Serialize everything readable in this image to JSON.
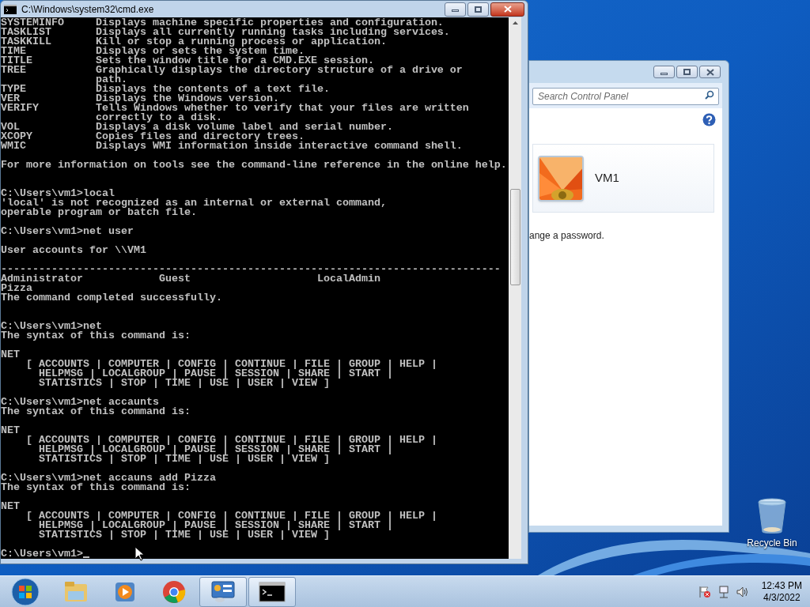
{
  "cmd_window": {
    "title": "C:\\Windows\\system32\\cmd.exe",
    "cursor": true,
    "console": [
      {
        "kind": "text",
        "text": "SYSTEMINFO     Displays machine specific properties and configuration."
      },
      {
        "kind": "text",
        "text": "TASKLIST       Displays all currently running tasks including services."
      },
      {
        "kind": "text",
        "text": "TASKKILL       Kill or stop a running process or application."
      },
      {
        "kind": "text",
        "text": "TIME           Displays or sets the system time."
      },
      {
        "kind": "text",
        "text": "TITLE          Sets the window title for a CMD.EXE session."
      },
      {
        "kind": "text",
        "text": "TREE           Graphically displays the directory structure of a drive or"
      },
      {
        "kind": "text",
        "text": "               path."
      },
      {
        "kind": "text",
        "text": "TYPE           Displays the contents of a text file."
      },
      {
        "kind": "text",
        "text": "VER            Displays the Windows version."
      },
      {
        "kind": "text",
        "text": "VERIFY         Tells Windows whether to verify that your files are written"
      },
      {
        "kind": "text",
        "text": "               correctly to a disk."
      },
      {
        "kind": "text",
        "text": "VOL            Displays a disk volume label and serial number."
      },
      {
        "kind": "text",
        "text": "XCOPY          Copies files and directory trees."
      },
      {
        "kind": "text",
        "text": "WMIC           Displays WMI information inside interactive command shell."
      },
      {
        "kind": "blank"
      },
      {
        "kind": "text",
        "text": "For more information on tools see the command-line reference in the online help."
      },
      {
        "kind": "blank"
      },
      {
        "kind": "blank"
      },
      {
        "kind": "text",
        "text": "C:\\Users\\vm1>local"
      },
      {
        "kind": "text",
        "text": "'local' is not recognized as an internal or external command,"
      },
      {
        "kind": "text",
        "text": "operable program or batch file."
      },
      {
        "kind": "blank"
      },
      {
        "kind": "text",
        "text": "C:\\Users\\vm1>net user"
      },
      {
        "kind": "blank"
      },
      {
        "kind": "text",
        "text": "User accounts for \\\\VM1"
      },
      {
        "kind": "blank"
      },
      {
        "kind": "text",
        "text": "-------------------------------------------------------------------------------"
      },
      {
        "kind": "text",
        "text": "Administrator            Guest                    LocalAdmin"
      },
      {
        "kind": "text",
        "text": "Pizza"
      },
      {
        "kind": "text",
        "text": "The command completed successfully."
      },
      {
        "kind": "blank"
      },
      {
        "kind": "blank"
      },
      {
        "kind": "text",
        "text": "C:\\Users\\vm1>net"
      },
      {
        "kind": "text",
        "text": "The syntax of this command is:"
      },
      {
        "kind": "blank"
      },
      {
        "kind": "text",
        "text": "NET"
      },
      {
        "kind": "text",
        "text": "    [ ACCOUNTS | COMPUTER | CONFIG | CONTINUE | FILE | GROUP | HELP |"
      },
      {
        "kind": "text",
        "text": "      HELPMSG | LOCALGROUP | PAUSE | SESSION | SHARE | START |"
      },
      {
        "kind": "text",
        "text": "      STATISTICS | STOP | TIME | USE | USER | VIEW ]"
      },
      {
        "kind": "blank"
      },
      {
        "kind": "text",
        "text": "C:\\Users\\vm1>net accaunts"
      },
      {
        "kind": "text",
        "text": "The syntax of this command is:"
      },
      {
        "kind": "blank"
      },
      {
        "kind": "text",
        "text": "NET"
      },
      {
        "kind": "text",
        "text": "    [ ACCOUNTS | COMPUTER | CONFIG | CONTINUE | FILE | GROUP | HELP |"
      },
      {
        "kind": "text",
        "text": "      HELPMSG | LOCALGROUP | PAUSE | SESSION | SHARE | START |"
      },
      {
        "kind": "text",
        "text": "      STATISTICS | STOP | TIME | USE | USER | VIEW ]"
      },
      {
        "kind": "blank"
      },
      {
        "kind": "text",
        "text": "C:\\Users\\vm1>net accauns add Pizza"
      },
      {
        "kind": "text",
        "text": "The syntax of this command is:"
      },
      {
        "kind": "blank"
      },
      {
        "kind": "text",
        "text": "NET"
      },
      {
        "kind": "text",
        "text": "    [ ACCOUNTS | COMPUTER | CONFIG | CONTINUE | FILE | GROUP | HELP |"
      },
      {
        "kind": "text",
        "text": "      HELPMSG | LOCALGROUP | PAUSE | SESSION | SHARE | START |"
      },
      {
        "kind": "text",
        "text": "      STATISTICS | STOP | TIME | USE | USER | VIEW ]"
      },
      {
        "kind": "blank"
      },
      {
        "kind": "text",
        "text": "C:\\Users\\vm1>"
      }
    ]
  },
  "control_panel": {
    "search": {
      "placeholder": "Search Control Panel"
    },
    "account": {
      "name": "VM1"
    },
    "text": "ange a password."
  },
  "desktop_icons": [
    {
      "label": "Recycle Bin"
    }
  ],
  "taskbar": {
    "items": [
      {
        "kind": "start",
        "active": false
      },
      {
        "kind": "folder",
        "active": false
      },
      {
        "kind": "media",
        "active": false
      },
      {
        "kind": "browser",
        "active": false
      },
      {
        "kind": "control-panel",
        "active": true
      },
      {
        "kind": "console",
        "active": true
      }
    ],
    "clock": {
      "time": "12:43 PM",
      "date": "4/3/2022"
    }
  }
}
